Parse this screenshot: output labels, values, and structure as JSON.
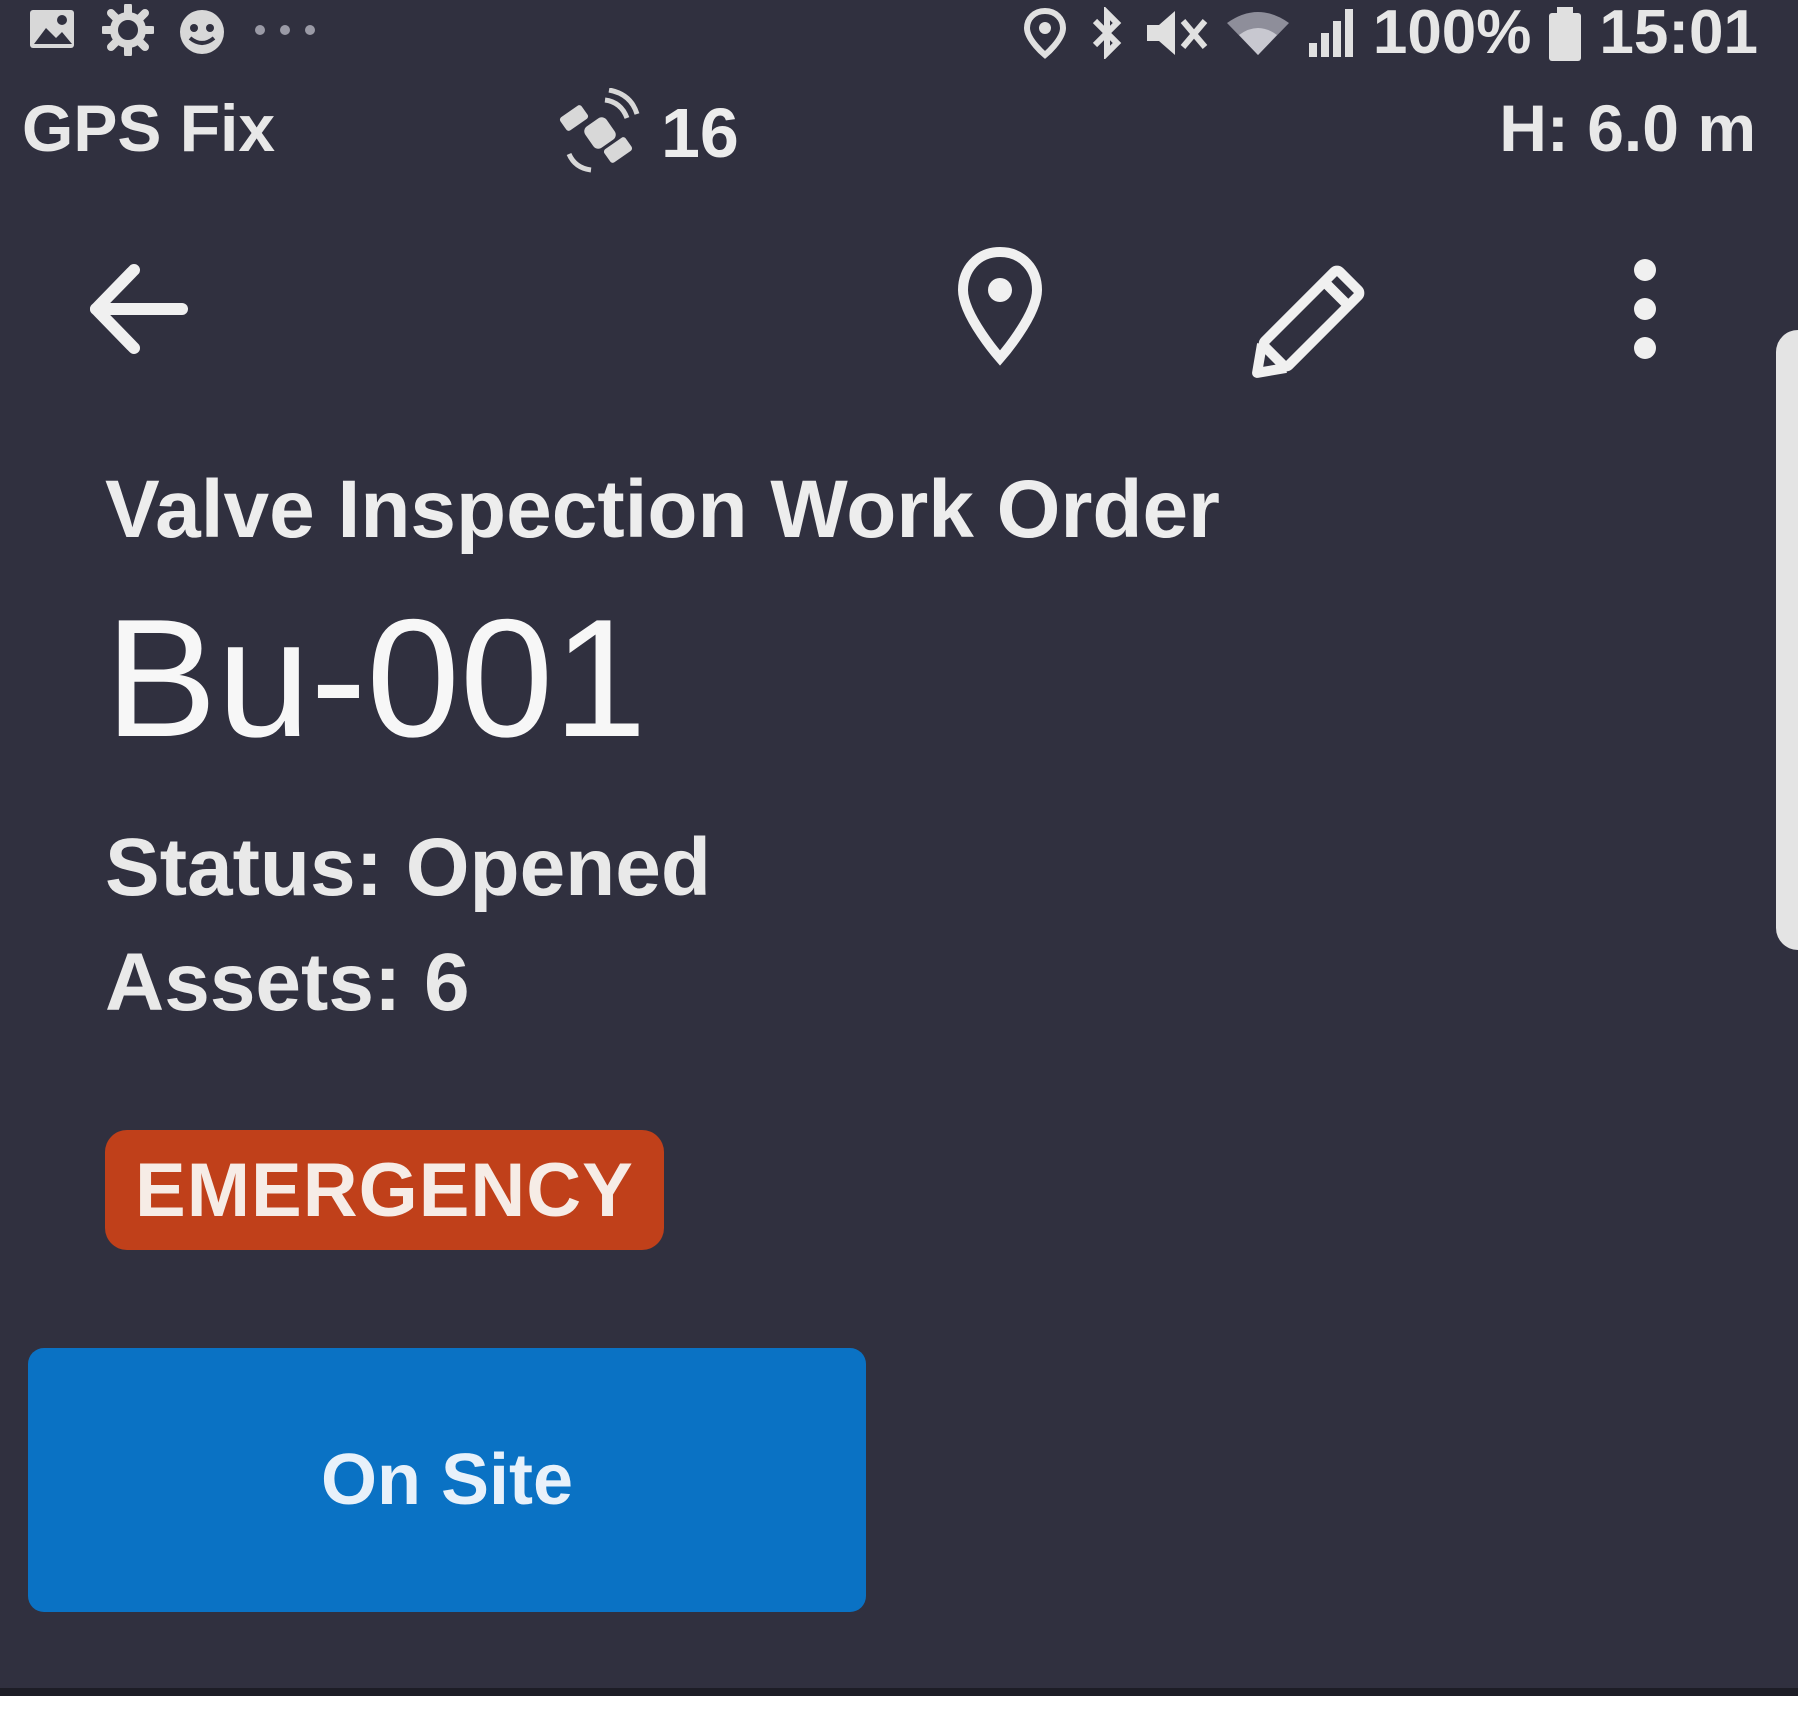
{
  "status_bar": {
    "left_icons": [
      "image-icon",
      "settings-cog-icon",
      "smiley-icon",
      "more-dots-icon"
    ],
    "right_icons": [
      "location-pin-icon",
      "bluetooth-icon",
      "mute-icon",
      "wifi-icon",
      "signal-icon",
      "battery-icon"
    ],
    "battery_text": "100%",
    "time": "15:01"
  },
  "gps": {
    "fix_label": "GPS Fix",
    "satellite_icon": "satellite-icon",
    "satellite_count": "16",
    "height_text": "H: 6.0 m"
  },
  "toolbar": {
    "icons": [
      "arrow-left-icon",
      "map-pin-icon",
      "pencil-icon",
      "vertical-dots-icon"
    ]
  },
  "work_order": {
    "type": "Valve Inspection Work Order",
    "id": "Bu-001",
    "status_line": "Status: Opened",
    "assets_line": "Assets: 6",
    "priority_badge": "EMERGENCY"
  },
  "actions": {
    "primary_label": "On Site"
  },
  "colors": {
    "background": "#30303f",
    "badge": "#c0401a",
    "primary_button": "#0a72c4",
    "text": "#f2f2f2"
  }
}
